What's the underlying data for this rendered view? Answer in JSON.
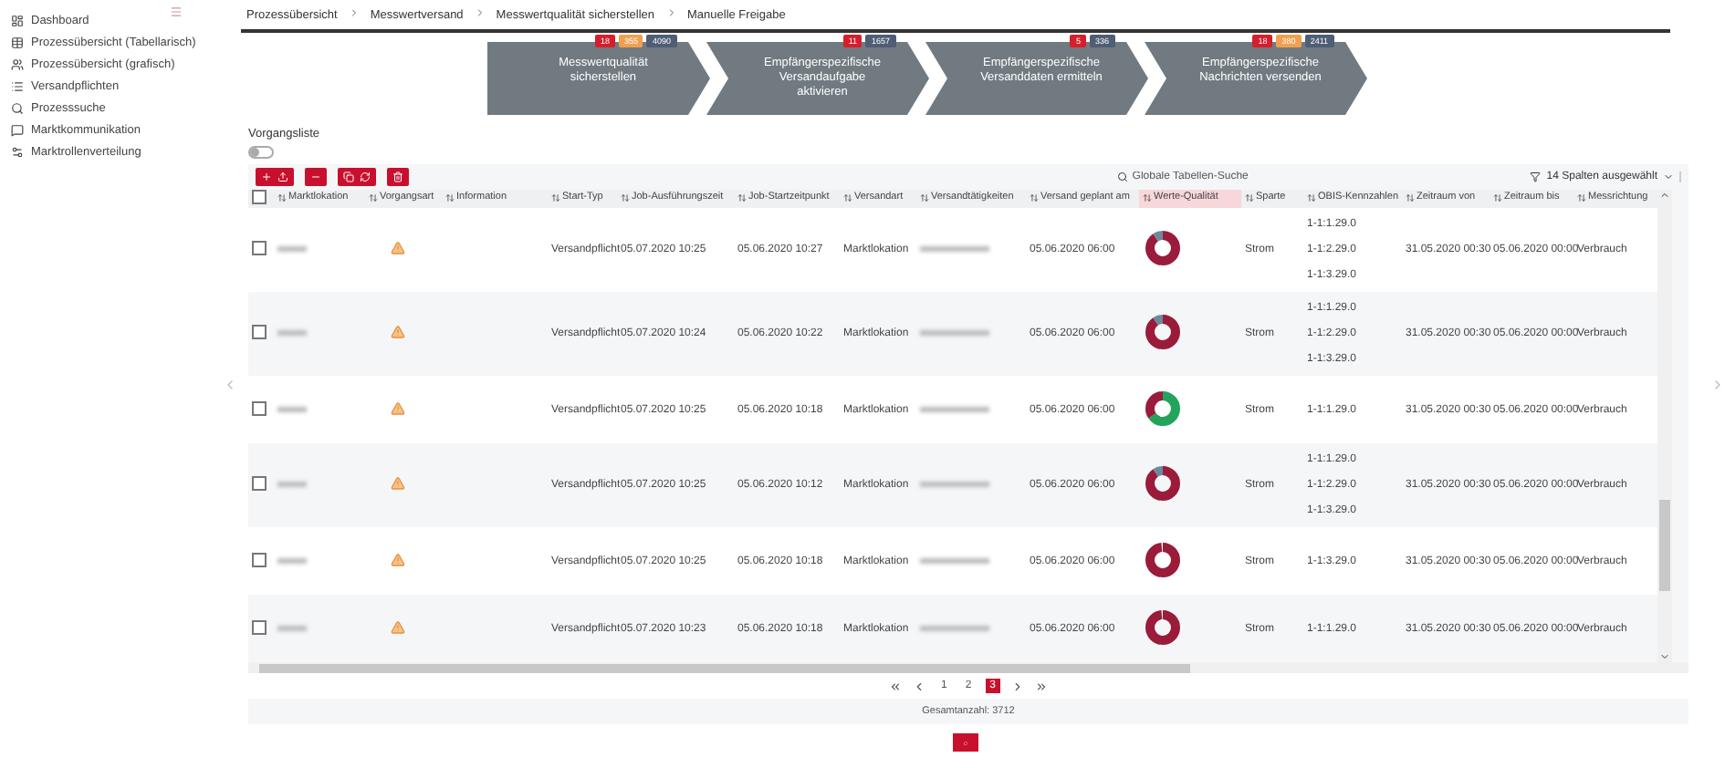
{
  "sidebar": {
    "items": [
      {
        "label": "Dashboard",
        "selected": false
      },
      {
        "label": "Prozessübersicht (Tabellarisch)",
        "selected": false
      },
      {
        "label": "Prozessübersicht (grafisch)",
        "selected": false
      },
      {
        "label": "Versandpflichten",
        "selected": false
      },
      {
        "label": "Prozesssuche",
        "selected": false
      },
      {
        "label": "Marktkommunikation",
        "selected": false
      },
      {
        "label": "Marktrollenverteilung",
        "selected": false
      }
    ]
  },
  "breadcrumb": [
    "Prozessübersicht",
    "Messwertversand",
    "Messwertqualität sicherstellen",
    "Manuelle Freigabe"
  ],
  "steps": [
    {
      "lines": [
        "Messwertqualität",
        "sicherstellen"
      ],
      "badges": [
        {
          "kind": "error",
          "text": "18"
        },
        {
          "kind": "warning",
          "text": "355"
        },
        {
          "kind": "count",
          "text": "4090"
        }
      ]
    },
    {
      "lines": [
        "Empfängerspezifische",
        "Versandaufgabe",
        "aktivieren"
      ],
      "badges": [
        {
          "kind": "error",
          "text": "11"
        },
        {
          "kind": "count",
          "text": "1657"
        }
      ]
    },
    {
      "lines": [
        "Empfängerspezifische",
        "Versanddaten ermitteln"
      ],
      "badges": [
        {
          "kind": "error",
          "text": "5"
        },
        {
          "kind": "count",
          "text": "336"
        }
      ]
    },
    {
      "lines": [
        "Empfängerspezifische",
        "Nachrichten versenden"
      ],
      "badges": [
        {
          "kind": "error",
          "text": "18"
        },
        {
          "kind": "warning",
          "text": "380"
        },
        {
          "kind": "count",
          "text": "2411"
        }
      ]
    }
  ],
  "list": {
    "title": "Vorgangsliste",
    "toggle_on": false,
    "select_all_checked": false,
    "search": {
      "placeholder": "Globale Tabellen-Suche"
    },
    "column_picker": {
      "value": "14 Spalten ausgewählt"
    },
    "columns": [
      {
        "label": "Marktlokation",
        "sorted": false
      },
      {
        "label": "Vorgangsart",
        "sorted": false
      },
      {
        "label": "Information",
        "sorted": false
      },
      {
        "label": "Start-Typ",
        "sorted": false
      },
      {
        "label": "Job-Ausführungszeit",
        "sorted": false
      },
      {
        "label": "Job-Startzeitpunkt",
        "sorted": false
      },
      {
        "label": "Versandart",
        "sorted": false
      },
      {
        "label": "Versandtätigkeiten",
        "sorted": false
      },
      {
        "label": "Versand geplant am",
        "sorted": false
      },
      {
        "label": "Werte-Qualität",
        "sorted": true
      },
      {
        "label": "Sparte",
        "sorted": false
      },
      {
        "label": "OBIS-Kennzahlen",
        "sorted": false
      },
      {
        "label": "Zeitraum von",
        "sorted": false
      },
      {
        "label": "Zeitraum bis",
        "sorted": false
      },
      {
        "label": "Messrichtung",
        "sorted": false
      }
    ],
    "rows": [
      {
        "checked": false,
        "start_type": "Versandpflicht",
        "job_run": "05.07.2020 10:25",
        "job_start": "05.06.2020 10:27",
        "mode": "Marktlokation",
        "planned": "05.06.2020 06:00",
        "quality": {
          "kind": "mixed"
        },
        "sparte": "Strom",
        "obis": [
          "1-1:1.29.0",
          "1-1:2.29.0",
          "1-1:3.29.0"
        ],
        "from": "31.05.2020 00:30",
        "to": "05.06.2020 00:00",
        "direction": "Verbrauch"
      },
      {
        "checked": false,
        "start_type": "Versandpflicht",
        "job_run": "05.07.2020 10:24",
        "job_start": "05.06.2020 10:22",
        "mode": "Marktlokation",
        "planned": "05.06.2020 06:00",
        "quality": {
          "kind": "mixed"
        },
        "sparte": "Strom",
        "obis": [
          "1-1:1.29.0",
          "1-1:2.29.0",
          "1-1:3.29.0"
        ],
        "from": "31.05.2020 00:30",
        "to": "05.06.2020 00:00",
        "direction": "Verbrauch"
      },
      {
        "checked": false,
        "start_type": "Versandpflicht",
        "job_run": "05.07.2020 10:25",
        "job_start": "05.06.2020 10:18",
        "mode": "Marktlokation",
        "planned": "05.06.2020 06:00",
        "quality": {
          "kind": "good"
        },
        "sparte": "Strom",
        "obis": [
          "1-1:1.29.0"
        ],
        "from": "31.05.2020 00:30",
        "to": "05.06.2020 00:00",
        "direction": "Verbrauch"
      },
      {
        "checked": false,
        "start_type": "Versandpflicht",
        "job_run": "05.07.2020 10:25",
        "job_start": "05.06.2020 10:12",
        "mode": "Marktlokation",
        "planned": "05.06.2020 06:00",
        "quality": {
          "kind": "mixed"
        },
        "sparte": "Strom",
        "obis": [
          "1-1:1.29.0",
          "1-1:2.29.0",
          "1-1:3.29.0"
        ],
        "from": "31.05.2020 00:30",
        "to": "05.06.2020 00:00",
        "direction": "Verbrauch"
      },
      {
        "checked": false,
        "start_type": "Versandpflicht",
        "job_run": "05.07.2020 10:25",
        "job_start": "05.06.2020 10:18",
        "mode": "Marktlokation",
        "planned": "05.06.2020 06:00",
        "quality": {
          "kind": "bad"
        },
        "sparte": "Strom",
        "obis": [
          "1-1:3.29.0"
        ],
        "from": "31.05.2020 00:30",
        "to": "05.06.2020 00:00",
        "direction": "Verbrauch"
      },
      {
        "checked": false,
        "start_type": "Versandpflicht",
        "job_run": "05.07.2020 10:23",
        "job_start": "05.06.2020 10:18",
        "mode": "Marktlokation",
        "planned": "05.06.2020 06:00",
        "quality": {
          "kind": "bad"
        },
        "sparte": "Strom",
        "obis": [
          "1-1:1.29.0"
        ],
        "from": "31.05.2020 00:30",
        "to": "05.06.2020 00:00",
        "direction": "Verbrauch"
      }
    ],
    "pagination": {
      "pages": [
        {
          "label": "1",
          "selected": false
        },
        {
          "label": "2",
          "selected": false
        },
        {
          "label": "3",
          "selected": true
        }
      ]
    },
    "total": "Gesamtanzahl: 3712"
  }
}
